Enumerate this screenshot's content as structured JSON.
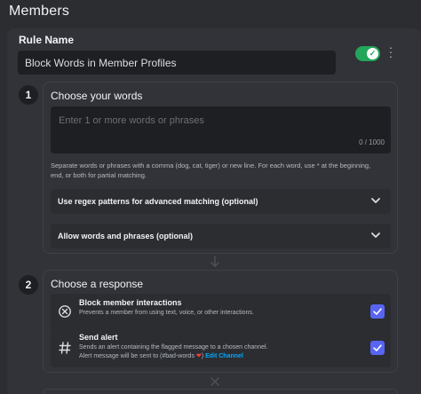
{
  "header": {
    "title": "Members"
  },
  "rule": {
    "name_label": "Rule Name",
    "name_value": "Block Words in Member Profiles",
    "enabled": true
  },
  "step1": {
    "number": "1",
    "title": "Choose your words",
    "placeholder": "Enter 1 or more words or phrases",
    "char_count": "0 / 1000",
    "helper_line1": "Separate words or phrases with a comma (dog, cat, tiger) or new line. For each word, use * at the beginning,",
    "helper_line2": "end, or both for partial matching.",
    "regex_label": "Use regex patterns for advanced matching (optional)",
    "allow_label": "Allow words and phrases (optional)"
  },
  "step2": {
    "number": "2",
    "title": "Choose a response",
    "actions": [
      {
        "title": "Block member interactions",
        "description": "Prevents a member from using text, voice, or other interactions.",
        "checked": true
      },
      {
        "title": "Send alert",
        "description": "Sends an alert containing the flagged message to a chosen channel.",
        "alert_prefix": "Alert message will be sent to (#bad-words",
        "alert_suffix": ")",
        "edit_link": "Edit Channel",
        "checked": true
      }
    ]
  },
  "colors": {
    "accent": "#5865f2",
    "toggle_on": "#23a55a",
    "link": "#00a8fc"
  }
}
